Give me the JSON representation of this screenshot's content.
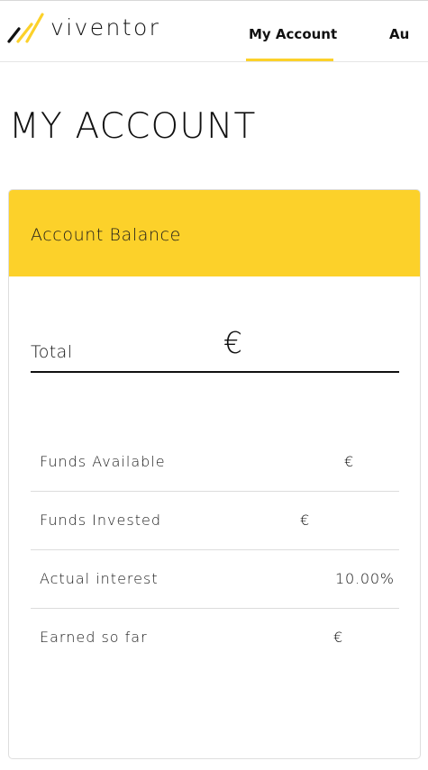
{
  "header": {
    "logo_text": "viventor",
    "nav": {
      "active_tab": "My Account",
      "next_tab": "Au"
    }
  },
  "page": {
    "title": "MY ACCOUNT"
  },
  "account_balance": {
    "header": "Account Balance",
    "total_label": "Total",
    "total_value": "€",
    "details": [
      {
        "label": "Funds Available",
        "value": "€"
      },
      {
        "label": "Funds Invested",
        "value": "€"
      },
      {
        "label": "Actual interest",
        "value": "10.00%"
      },
      {
        "label": "Earned so far",
        "value": "€"
      }
    ]
  },
  "colors": {
    "accent": "#fcd12a",
    "text": "#111111",
    "divider": "#dcdcdc"
  }
}
